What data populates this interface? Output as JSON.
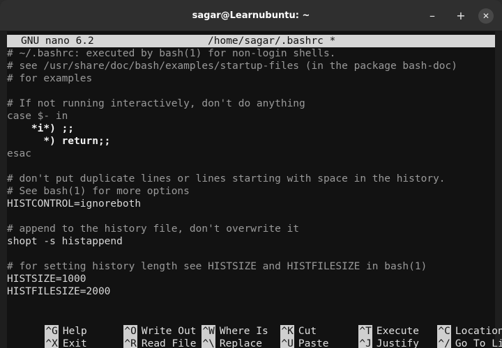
{
  "window": {
    "title": "sagar@Learnubuntu: ~",
    "minimize_glyph": "–",
    "maximize_glyph": "+",
    "close_glyph": "✕"
  },
  "nano": {
    "version": "GNU nano 6.2",
    "file": "/home/sagar/.bashrc *"
  },
  "lines": [
    "# ~/.bashrc: executed by bash(1) for non-login shells.",
    "# see /usr/share/doc/bash/examples/startup-files (in the package bash-doc)",
    "# for examples",
    "",
    "# If not running interactively, don't do anything",
    "case $- in",
    "    *i*) ;;",
    "      *) return;;",
    "esac",
    "",
    "# don't put duplicate lines or lines starting with space in the history.",
    "# See bash(1) for more options",
    "HISTCONTROL=ignoreboth",
    "",
    "# append to the history file, don't overwrite it",
    "shopt -s histappend",
    "",
    "# for setting history length see HISTSIZE and HISTFILESIZE in bash(1)",
    "HISTSIZE=1000",
    "HISTFILESIZE=2000"
  ],
  "shortcuts": {
    "row1": [
      {
        "key": "^G",
        "label": "Help"
      },
      {
        "key": "^O",
        "label": "Write Out"
      },
      {
        "key": "^W",
        "label": "Where Is"
      },
      {
        "key": "^K",
        "label": "Cut"
      },
      {
        "key": "^T",
        "label": "Execute"
      },
      {
        "key": "^C",
        "label": "Location"
      }
    ],
    "row2": [
      {
        "key": "^X",
        "label": "Exit"
      },
      {
        "key": "^R",
        "label": "Read File"
      },
      {
        "key": "^\\",
        "label": "Replace"
      },
      {
        "key": "^U",
        "label": "Paste"
      },
      {
        "key": "^J",
        "label": "Justify"
      },
      {
        "key": "^/",
        "label": "Go To Line"
      }
    ]
  }
}
